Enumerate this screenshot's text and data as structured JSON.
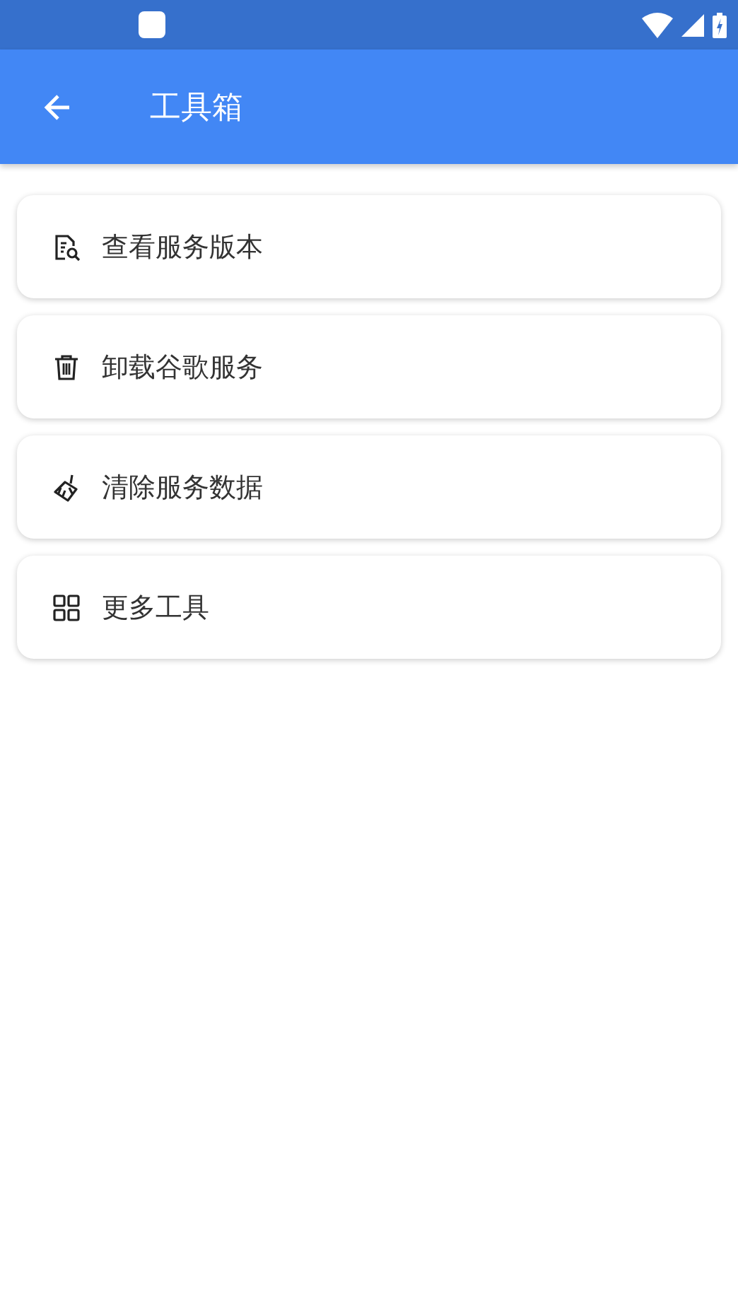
{
  "app_bar": {
    "title": "工具箱"
  },
  "items": [
    {
      "label": "查看服务版本"
    },
    {
      "label": "卸载谷歌服务"
    },
    {
      "label": "清除服务数据"
    },
    {
      "label": "更多工具"
    }
  ]
}
